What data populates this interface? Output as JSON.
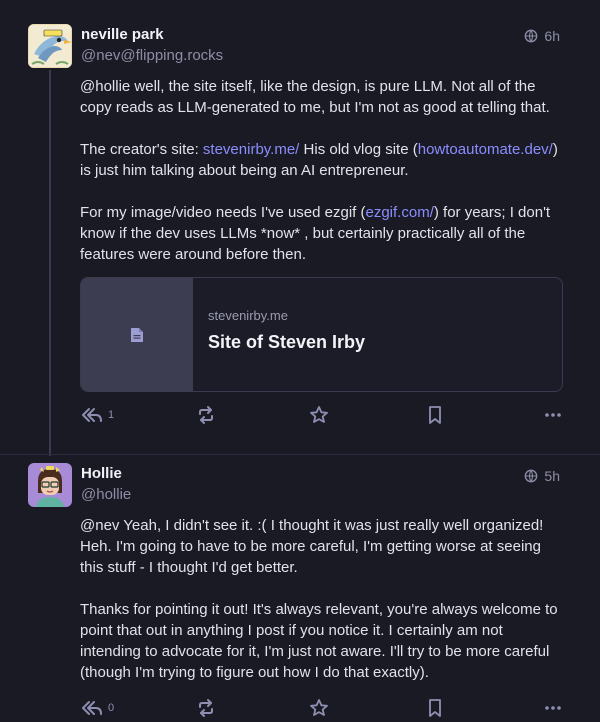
{
  "posts": [
    {
      "author": {
        "display_name": "neville park",
        "handle": "@nev@flipping.rocks"
      },
      "time": "6h",
      "paragraphs": [
        [
          {
            "text": "@hollie well, the site itself, like the design, is pure LLM. Not all of the copy reads as LLM-generated to me, but I'm not as good at telling that."
          }
        ],
        [
          {
            "text": "The creator's site: "
          },
          {
            "text": "stevenirby.me/",
            "link": true
          },
          {
            "text": " His old vlog site ("
          },
          {
            "text": "howtoautomate.dev/",
            "link": true
          },
          {
            "text": ") is just him talking about being an AI entrepreneur."
          }
        ],
        [
          {
            "text": "For my image/video needs I've used ezgif ("
          },
          {
            "text": "ezgif.com/",
            "link": true
          },
          {
            "text": ") for years; I don't know if the dev uses LLMs *now* , but certainly practically all of the features were around before then."
          }
        ]
      ],
      "card": {
        "domain": "stevenirby.me",
        "title": "Site of Steven Irby",
        "icon": "document-icon"
      },
      "reply_count": "1"
    },
    {
      "author": {
        "display_name": "Hollie",
        "handle": "@hollie"
      },
      "time": "5h",
      "paragraphs": [
        [
          {
            "text": "@nev Yeah, I didn't see it. :( I thought it was just really well organized! Heh. I'm going to have to be more careful, I'm getting worse at seeing this stuff - I thought I'd get better."
          }
        ],
        [
          {
            "text": "Thanks for pointing it out! It's always relevant, you're always welcome to point that out in anything I post if you notice it. I certainly am not intending to advocate for it, I'm just not aware. I'll try to be more careful (though I'm trying to figure out how I do that exactly)."
          }
        ]
      ],
      "reply_count": "0"
    }
  ],
  "icons": {
    "visibility": "globe-icon",
    "reply": "reply-all-icon",
    "boost": "boost-icon",
    "favourite": "star-icon",
    "bookmark": "bookmark-icon",
    "more": "more-icon"
  },
  "colors": {
    "background": "#191a24",
    "link": "#8c8dff",
    "muted": "#8d8ea6",
    "text": "#e2e2ea"
  }
}
